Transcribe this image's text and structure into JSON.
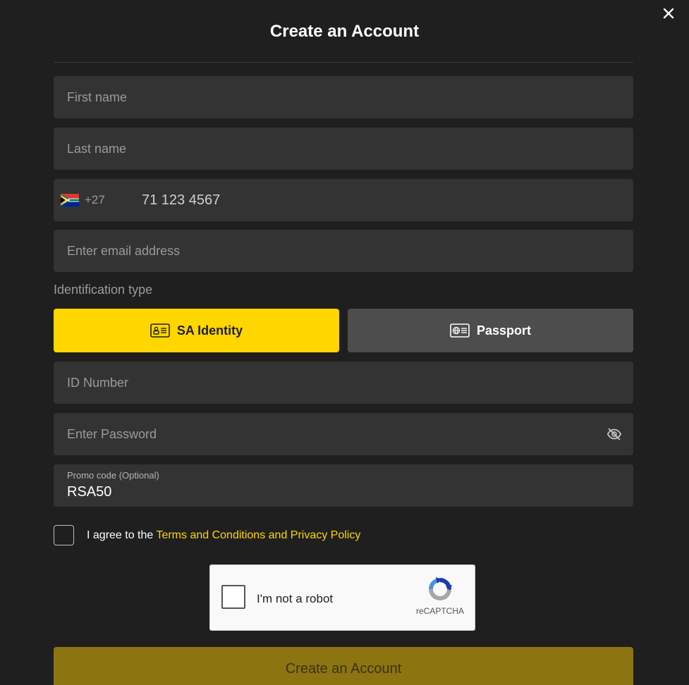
{
  "dialog": {
    "title": "Create an Account",
    "close_icon": "close-icon"
  },
  "fields": {
    "first_name_placeholder": "First name",
    "last_name_placeholder": "Last name",
    "email_placeholder": "Enter email address",
    "id_number_placeholder": "ID Number",
    "password_placeholder": "Enter Password"
  },
  "phone": {
    "country_flag_icon": "south-africa-flag-icon",
    "dial_code": "+27",
    "number_placeholder": "71 123 4567"
  },
  "identification": {
    "label": "Identification type",
    "options": [
      {
        "label": "SA Identity",
        "icon": "id-card-icon",
        "selected": true
      },
      {
        "label": "Passport",
        "icon": "passport-icon",
        "selected": false
      }
    ]
  },
  "promo": {
    "label": "Promo code (Optional)",
    "value": "RSA50"
  },
  "agree": {
    "text": "I agree to the",
    "link": "Terms and Conditions and Privacy Policy"
  },
  "recaptcha": {
    "label": "I'm not a robot",
    "brand": "reCAPTCHA"
  },
  "submit": {
    "label": "Create an Account"
  },
  "colors": {
    "background": "#1f1f1f",
    "field": "#333333",
    "accent": "#ffd600",
    "submit_disabled": "#8c7410"
  }
}
